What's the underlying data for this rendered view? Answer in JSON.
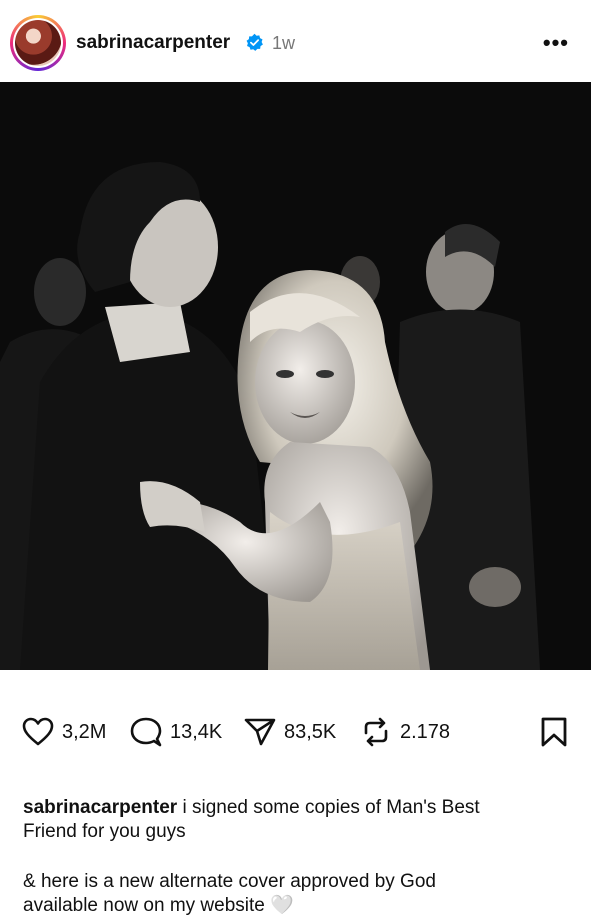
{
  "post": {
    "username": "sabrinacarpenter",
    "time_ago": "1w"
  },
  "actions": {
    "likes": "3,2M",
    "comments": "13,4K",
    "shares": "83,5K",
    "reposts": "2.178"
  },
  "caption": {
    "username": "sabrinacarpenter",
    "line1": "i signed some copies of Man's Best",
    "line2": "Friend for you guys",
    "line3": "& here is a new alternate cover approved by God",
    "line4": "available now on my website",
    "emoji": "🤍"
  },
  "colors": {
    "verified": "#0095f6",
    "photo_bg": "#0b0b0b"
  }
}
